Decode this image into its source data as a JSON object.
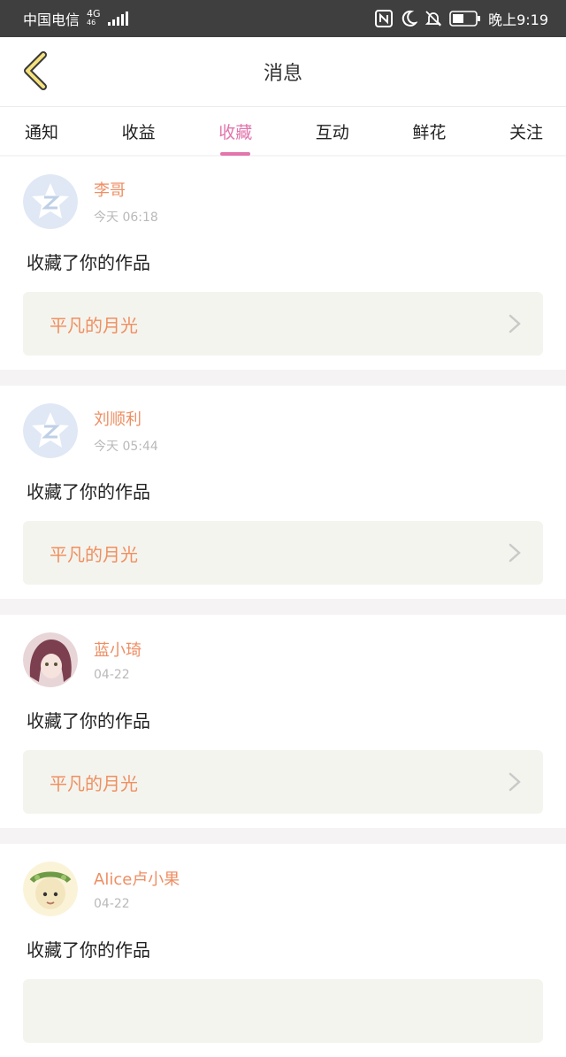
{
  "status_bar": {
    "carrier": "中国电信",
    "network": "4G",
    "network_sub": "46",
    "time": "晚上9:19",
    "icons": [
      "nfc-icon",
      "moon-icon",
      "bell-off-icon",
      "battery-icon"
    ]
  },
  "header": {
    "title": "消息",
    "back_icon": "chevron-left-icon"
  },
  "tabs": [
    {
      "label": "通知",
      "active": false
    },
    {
      "label": "收益",
      "active": false
    },
    {
      "label": "收藏",
      "active": true
    },
    {
      "label": "互动",
      "active": false
    },
    {
      "label": "鲜花",
      "active": false
    },
    {
      "label": "关注",
      "active": false
    }
  ],
  "colors": {
    "accent": "#e275ac",
    "name": "#ee8e63",
    "work": "#ef8f5f",
    "card_bg": "#f4f4ef"
  },
  "messages": [
    {
      "user": "李哥",
      "time": "今天 06:18",
      "action": "收藏了你的作品",
      "work": "平凡的月光",
      "avatar": "qq-default-avatar"
    },
    {
      "user": "刘顺利",
      "time": "今天 05:44",
      "action": "收藏了你的作品",
      "work": "平凡的月光",
      "avatar": "qq-default-avatar"
    },
    {
      "user": "蓝小琦",
      "time": "04-22",
      "action": "收藏了你的作品",
      "work": "平凡的月光",
      "avatar": "anime-girl-avatar"
    },
    {
      "user": "Alice卢小果",
      "time": "04-22",
      "action": "收藏了你的作品",
      "work": "",
      "avatar": "flower-crown-avatar"
    }
  ]
}
